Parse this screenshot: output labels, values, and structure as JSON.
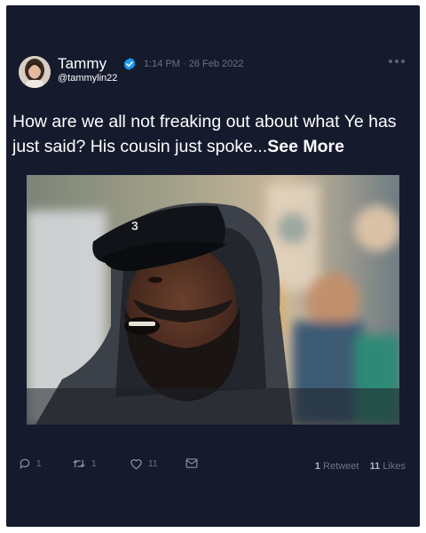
{
  "tweet": {
    "author_name": "Tammy",
    "handle": "@tammylin22",
    "timestamp": "1:14 PM · 26 Feb 2022",
    "text": "How are we all not freaking out about what Ye has just said? His cousin just spoke...",
    "see_more_label": "See More",
    "verified": true
  },
  "actions": {
    "reply_count": "1",
    "retweet_count": "1",
    "like_count": "11"
  },
  "stats": {
    "retweets_value": "1",
    "retweets_label": "Retweet",
    "likes_value": "11",
    "likes_label": "Likes"
  },
  "colors": {
    "card_background": "#151a2d",
    "verified_badge": "#1d9bf0",
    "muted_text": "#6b7389"
  },
  "icons": [
    "verified-badge-icon",
    "more-options-icon",
    "reply-icon",
    "retweet-icon",
    "like-icon",
    "share-icon"
  ]
}
